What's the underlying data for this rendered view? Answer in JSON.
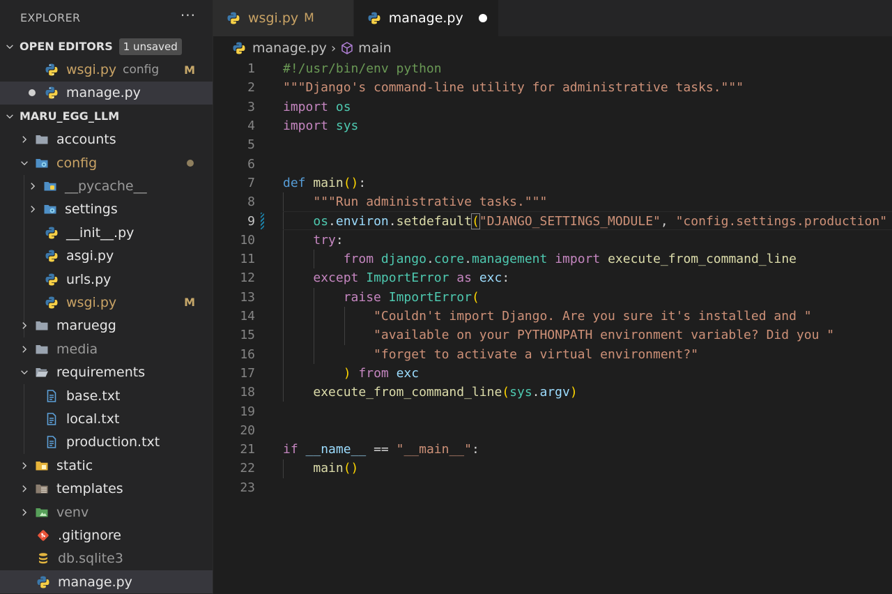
{
  "explorer": {
    "title": "EXPLORER",
    "more": "···",
    "open_editors": {
      "label": "OPEN EDITORS",
      "badge": "1 unsaved",
      "items": [
        {
          "name": "wsgi.py",
          "desc": "config",
          "status": "M"
        },
        {
          "name": "manage.py"
        }
      ]
    },
    "project": {
      "label": "MARU_EGG_LLM",
      "items": [
        {
          "name": "accounts"
        },
        {
          "name": "config"
        },
        {
          "name": "__pycache__"
        },
        {
          "name": "settings"
        },
        {
          "name": "__init__.py"
        },
        {
          "name": "asgi.py"
        },
        {
          "name": "urls.py"
        },
        {
          "name": "wsgi.py",
          "status": "M"
        },
        {
          "name": "maruegg"
        },
        {
          "name": "media"
        },
        {
          "name": "requirements"
        },
        {
          "name": "base.txt"
        },
        {
          "name": "local.txt"
        },
        {
          "name": "production.txt"
        },
        {
          "name": "static"
        },
        {
          "name": "templates"
        },
        {
          "name": "venv"
        },
        {
          "name": ".gitignore"
        },
        {
          "name": "db.sqlite3"
        },
        {
          "name": "manage.py"
        }
      ]
    }
  },
  "tabs": [
    {
      "name": "wsgi.py",
      "status": "M"
    },
    {
      "name": "manage.py"
    }
  ],
  "breadcrumb": {
    "file": "manage.py",
    "symbol": "main"
  },
  "editor": {
    "line_numbers": [
      "1",
      "2",
      "3",
      "4",
      "5",
      "6",
      "7",
      "8",
      "9",
      "10",
      "11",
      "12",
      "13",
      "14",
      "15",
      "16",
      "17",
      "18",
      "19",
      "20",
      "21",
      "22",
      "23"
    ],
    "code": {
      "l1": "#!/usr/bin/env python",
      "l2": "\"\"\"Django's command-line utility for administrative tasks.\"\"\"",
      "l3_kw": "import",
      "l3_mod": "os",
      "l4_kw": "import",
      "l4_mod": "sys",
      "l7_kw": "def",
      "l7_fn": "main",
      "l8": "\"\"\"Run administrative tasks.\"\"\"",
      "l9_a": "os",
      "l9_b": "environ",
      "l9_fn": "setdefault",
      "l9_s1": "\"DJANGO_SETTINGS_MODULE\"",
      "l9_s2": "\"config.settings.production\"",
      "l10_kw": "try",
      "l11_kw1": "from",
      "l11_m1": "django",
      "l11_m2": "core",
      "l11_m3": "management",
      "l11_kw2": "import",
      "l11_fn": "execute_from_command_line",
      "l12_kw1": "except",
      "l12_cls": "ImportError",
      "l12_kw2": "as",
      "l12_var": "exc",
      "l13_kw": "raise",
      "l13_cls": "ImportError",
      "l14": "\"Couldn't import Django. Are you sure it's installed and \"",
      "l15": "\"available on your PYTHONPATH environment variable? Did you \"",
      "l16": "\"forget to activate a virtual environment?\"",
      "l17_kw": "from",
      "l17_var": "exc",
      "l18_fn": "execute_from_command_line",
      "l18_a": "sys",
      "l18_b": "argv",
      "l21_kw": "if",
      "l21_var": "__name__",
      "l21_op": "==",
      "l21_str": "\"__main__\"",
      "l22_fn": "main"
    }
  },
  "colors": {
    "modified": "#c9a365",
    "keyword": "#569cd6",
    "control": "#c586c0",
    "string": "#ce9178",
    "function": "#dcdcaa",
    "variable": "#9cdcfe",
    "class": "#4ec9b0"
  }
}
